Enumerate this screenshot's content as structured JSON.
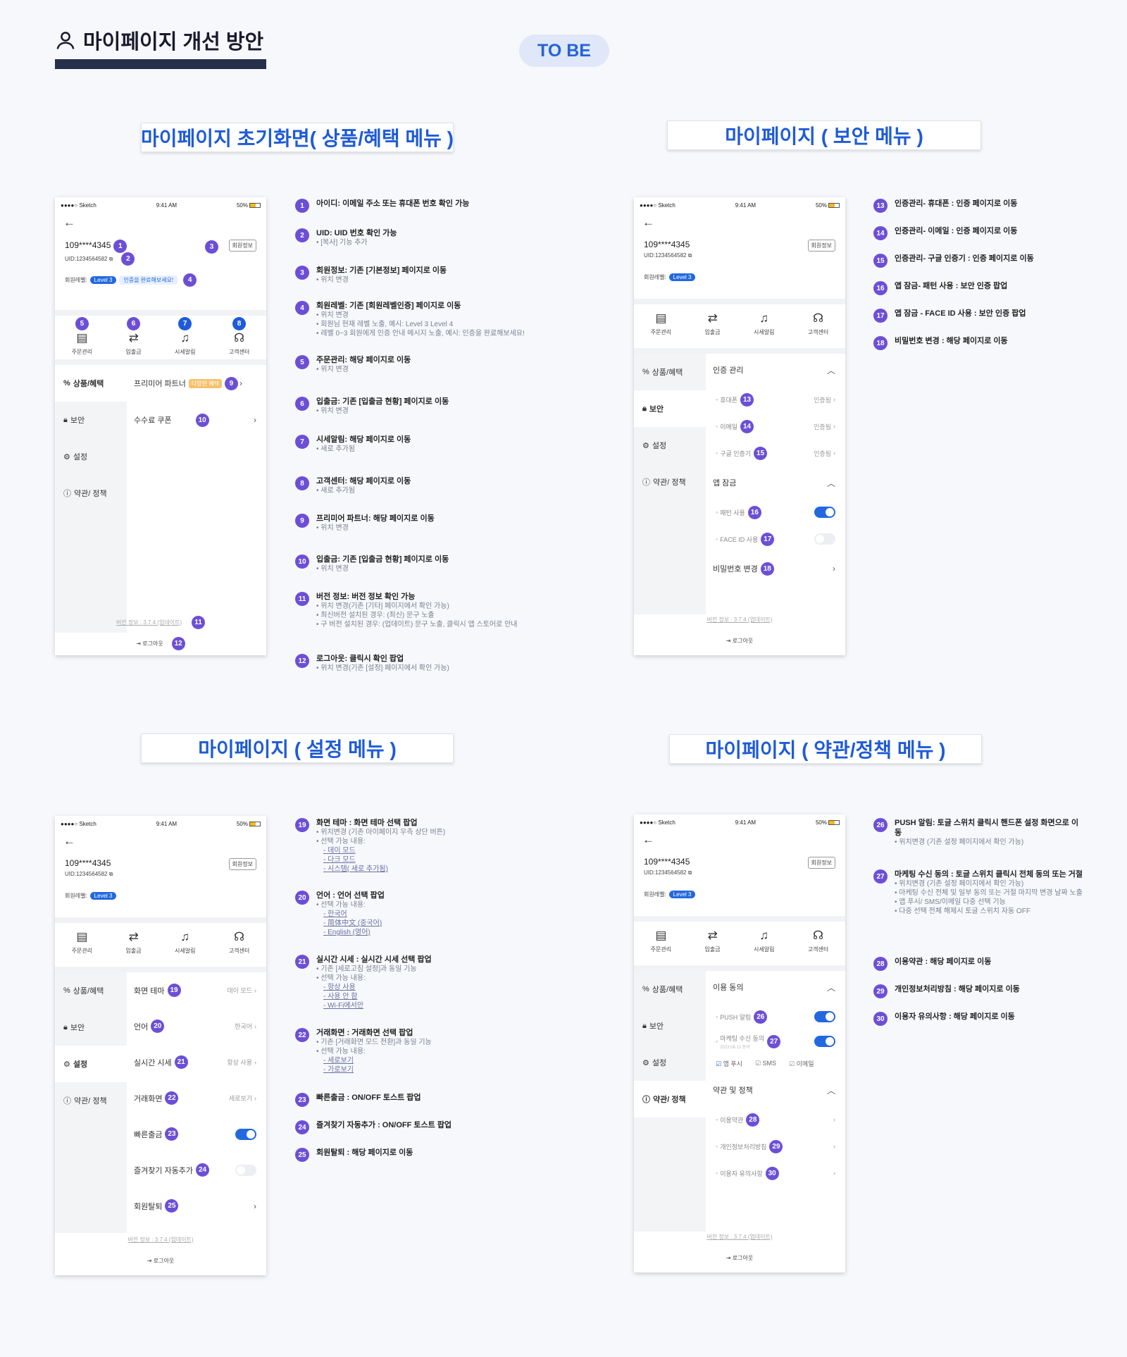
{
  "header": {
    "title": "마이페이지 개선 방안",
    "tobe": "TO BE"
  },
  "sections": {
    "s1": "마이페이지 초기화면( 상품/혜택 메뉴 )",
    "s2": "마이페이지 ( 보안 메뉴 )",
    "s3": "마이페이지 ( 설정 메뉴 )",
    "s4": "마이페이지 ( 약관/정책 메뉴 )"
  },
  "phone": {
    "carrier": "●●●●○ Sketch",
    "time": "9:41 AM",
    "battery": "50%",
    "back": "←",
    "uid": "109****4345",
    "uid_sub": "UID:1234564582",
    "info_btn": "회원정보",
    "level_label": "회원레벨:",
    "level": "Level 3",
    "cert_msg": "인증을 완료해보세요!",
    "quick": [
      "주문관리",
      "입출금",
      "시세알림",
      "고객센터"
    ],
    "menu": [
      "상품/혜택",
      "보안",
      "설정",
      "약관/ 정책"
    ],
    "version": "버전 정보 : 3.7.4 (업데이트)",
    "logout": "로그아웃"
  },
  "p1": {
    "premium": "프리미어 파트너",
    "premium_tag": "다양한 혜택",
    "coupon": "수수료 쿠폰"
  },
  "p2": {
    "auth": "인증 관리",
    "phone": "휴대폰",
    "email": "이메일",
    "google": "구글 인증기",
    "done": "인증됨",
    "lock": "앱 잠금",
    "pattern": "패턴 사용",
    "faceid": "FACE ID 사용",
    "pw": "비밀번호 변경"
  },
  "p3": {
    "theme": "화면 테마",
    "theme_v": "데이 모드",
    "lang": "언어",
    "lang_v": "한국어",
    "realtime": "실시간 시세",
    "realtime_v": "항상 사용",
    "trade": "거래화면",
    "trade_v": "세로보기",
    "quickout": "빠른출금",
    "fav": "즐겨찾기 자동추가",
    "withdraw": "회원탈퇴"
  },
  "p4": {
    "consent": "이용 동의",
    "push": "PUSH 알림",
    "mkt": "마케팅 수신 동의",
    "mkt_date": "2022.08.12 동의",
    "c_push": "앱 푸시",
    "c_sms": "SMS",
    "c_email": "이메일",
    "terms_hd": "약관 및 정책",
    "terms": "이용약관",
    "privacy": "개인정보처리방침",
    "notice": "이용자 유의사항"
  },
  "ann1": [
    {
      "n": "1",
      "t": "아이디: 이메일 주소 또는 휴대폰 번호 확인 가능",
      "s": []
    },
    {
      "n": "2",
      "t": "UID: UID 번호 확인 가능",
      "s": [
        "• [복사] 기능 추가"
      ]
    },
    {
      "n": "3",
      "t": "회원정보: 기존 [기본정보] 페이지로 이동",
      "s": [
        "• 위치 변경"
      ]
    },
    {
      "n": "4",
      "t": "회원레벨: 기존 [회원레벨인증] 페이지로 이동",
      "s": [
        "• 위치 변경",
        "• 회원님 현재 레벨 노출, 예시: Level 3 Level 4",
        "• 레벨 0~3 회원에게 인증 안내 메시지 노출, 예시: 인증을 완료해보세요!"
      ]
    },
    {
      "n": "5",
      "t": "주문관리: 해당 페이지로 이동",
      "s": [
        "• 위치 변경"
      ]
    },
    {
      "n": "6",
      "t": "입출금: 기존 [입출금 현황] 페이지로 이동",
      "s": [
        "• 위치 변경"
      ]
    },
    {
      "n": "7",
      "t": "시세알림: 해당 페이지로 이동",
      "s": [
        "• 새로 추가됨"
      ]
    },
    {
      "n": "8",
      "t": "고객센터: 해당 페이지로 이동",
      "s": [
        "• 새로 추가됨"
      ]
    },
    {
      "n": "9",
      "t": "프리미어 파트너: 해당 페이지로 이동",
      "s": [
        "• 위치 변경"
      ]
    },
    {
      "n": "10",
      "t": "입출금: 기존 [입출금 현황] 페이지로 이동",
      "s": [
        "• 위치 변경"
      ]
    },
    {
      "n": "11",
      "t": "버전 정보: 버전 정보 확인 가능",
      "s": [
        "• 위치 변경(기존 [기타] 페이지에서 확인 가능)",
        "• 최신버전 설치된 경우: (최신) 문구 노출",
        "• 구 버전 설치된 경우: (업데이트) 문구 노출, 클릭시 앱 스토어로 안내"
      ]
    },
    {
      "n": "12",
      "t": "로그아웃: 클릭시 확인 팝업",
      "s": [
        "• 위치 변경(기존 [설정] 페이지에서 확인 가능)"
      ]
    }
  ],
  "ann2": [
    {
      "n": "13",
      "t": "인증관리- 휴대폰 : 인증 페이지로 이동"
    },
    {
      "n": "14",
      "t": "인증관리- 이메일 : 인증 페이지로 이동"
    },
    {
      "n": "15",
      "t": "인증관리- 구글 인증기 : 인증 페이지로 이동"
    },
    {
      "n": "16",
      "t": "앱 잠금- 패턴 사용 : 보안 인증 팝업"
    },
    {
      "n": "17",
      "t": "앱 잠금 - FACE ID 사용 : 보안 인증 팝업"
    },
    {
      "n": "18",
      "t": "비밀번호 변경 : 해당 페이지로 이동"
    }
  ],
  "ann3": [
    {
      "n": "19",
      "t": "화면 테마 : 화면 테마 선택 팝업",
      "s": [
        "• 위치변경 (기존 마이페이지 우측 상단 버튼)",
        "• 선택 가능 내용:"
      ],
      "u": [
        "- 데이 모드",
        "- 다크 모드",
        "- 시스템( 새로 추가됨)"
      ]
    },
    {
      "n": "20",
      "t": "언어 : 언어 선택 팝업",
      "s": [
        "• 선택 가능 내용:"
      ],
      "u": [
        "- 한국어",
        "- 简体中文 (중국어)",
        "- English (영어)"
      ]
    },
    {
      "n": "21",
      "t": "실시간 시세 : 실시간 시세 선택 팝업",
      "s": [
        "• 기존 [세로고침 설정]과 동일 기능",
        "• 선택 가능 내용:"
      ],
      "u": [
        "- 항상 사용",
        "- 사용 안 함",
        "- Wi-Fi에서만"
      ]
    },
    {
      "n": "22",
      "t": "거래화면 : 거래화면 선택 팝업",
      "s": [
        "• 기존 [거래화면 모드 전환]과 동일 기능",
        "• 선택 가능 내용:"
      ],
      "u": [
        "- 세로보기",
        "- 가로보기"
      ]
    },
    {
      "n": "23",
      "t": "빠른출금 : ON/OFF 토스트 팝업",
      "s": [],
      "u": []
    },
    {
      "n": "24",
      "t": "즐겨찾기 자동추가 : ON/OFF 토스트 팝업",
      "s": [],
      "u": []
    },
    {
      "n": "25",
      "t": "회원탈퇴 : 해당 페이지로 이동",
      "s": [],
      "u": []
    }
  ],
  "ann4": [
    {
      "n": "26",
      "t": "PUSH 알림: 토글 스위치 클릭시 핸드폰 설정 화면으로 이동",
      "s": [
        "• 위치변경 (기존 설정 페이지에서 확인 가능)"
      ]
    },
    {
      "n": "27",
      "t": "마케팅 수신 동의 : 토글 스위치 클릭시 전체 동의 또는 거절",
      "s": [
        "• 위치변경 (기존 설정 페이지에서 확인 가능)",
        "• 마케팅 수신 전체 및 일부 동의 또는 거절 마지막 변경 날짜 노출",
        "• 앱 푸시/ SMS/이메일 다중 선택 기능",
        "• 다중 선택 전체 해제시 토글 스위치 자동 OFF"
      ]
    },
    {
      "n": "28",
      "t": "이용약관 : 해당 페이지로 이동",
      "s": []
    },
    {
      "n": "29",
      "t": "개인정보처리방침 : 해당 페이지로 이동",
      "s": []
    },
    {
      "n": "30",
      "t": "이용자 유의사항 : 해당 페이지로 이동",
      "s": []
    }
  ]
}
